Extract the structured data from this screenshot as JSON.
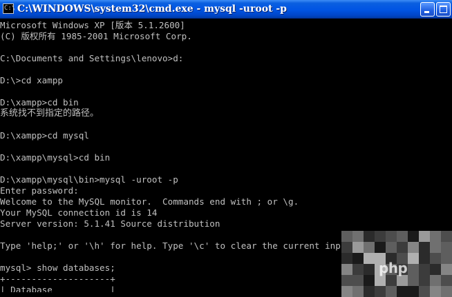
{
  "window": {
    "title": "C:\\WINDOWS\\system32\\cmd.exe - mysql -uroot -p",
    "title_icon_glyph": "C:\\",
    "minimize_icon": "minimize-icon",
    "maximize_icon": "maximize-icon"
  },
  "console": {
    "lines": [
      "Microsoft Windows XP [版本 5.1.2600]",
      "(C) 版权所有 1985-2001 Microsoft Corp.",
      "",
      "C:\\Documents and Settings\\lenovo>d:",
      "",
      "D:\\>cd xampp",
      "",
      "D:\\xampp>cd bin",
      "系统找不到指定的路径。",
      "",
      "D:\\xampp>cd mysql",
      "",
      "D:\\xampp\\mysql>cd bin",
      "",
      "D:\\xampp\\mysql\\bin>mysql -uroot -p",
      "Enter password:",
      "Welcome to the MySQL monitor.  Commands end with ; or \\g.",
      "Your MySQL connection id is 14",
      "Server version: 5.1.41 Source distribution",
      "",
      "Type 'help;' or '\\h' for help. Type '\\c' to clear the current input statement.",
      "",
      "mysql> show databases;",
      "+--------------------+",
      "| Database           |"
    ]
  },
  "watermark": {
    "text": "php"
  },
  "colors": {
    "titlebar": "#0054e3",
    "console_bg": "#000000",
    "console_text": "#c0c0c0"
  }
}
